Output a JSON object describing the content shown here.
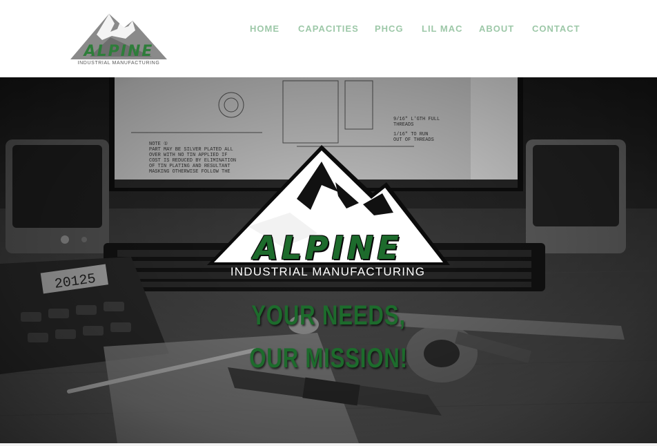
{
  "brand": {
    "name": "ALPINE",
    "subtitle": "INDUSTRIAL MANUFACTURING",
    "accent_color": "#2e7d3a",
    "logo_icon": "mountain-icon"
  },
  "nav": {
    "color": "#9dc8a8",
    "items": [
      {
        "label": "HOME"
      },
      {
        "label": "CAPACITIES"
      },
      {
        "label": "PHCG"
      },
      {
        "label": "LIL MAC"
      },
      {
        "label": "ABOUT"
      },
      {
        "label": "CONTACT"
      }
    ]
  },
  "hero": {
    "logo_name": "ALPINE",
    "logo_subtitle": "INDUSTRIAL MANUFACTURING",
    "tagline_line1": "YOUR NEEDS,",
    "tagline_line2": "OUR MISSION!",
    "tagline_color": "#1d6b2c",
    "background_description_icon": "workbench-photo",
    "calculator_display": "20125"
  }
}
